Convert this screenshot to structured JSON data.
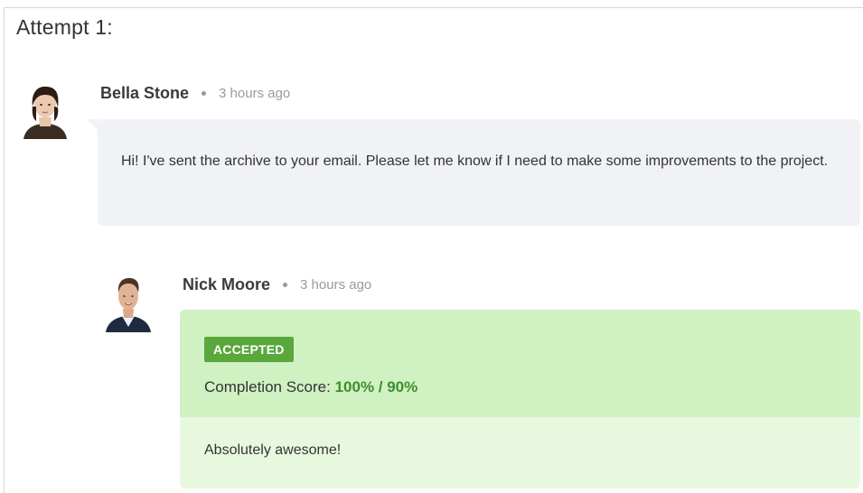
{
  "attempt": {
    "title": "Attempt 1:"
  },
  "comments": [
    {
      "author": "Bella Stone",
      "time": "3 hours ago",
      "text": "Hi! I've sent the archive to your email. Please let me know if I need to make some improvements to the project."
    },
    {
      "author": "Nick Moore",
      "time": "3 hours ago",
      "status": "ACCEPTED",
      "score_label": "Completion Score:",
      "score_value": "100% / 90%",
      "text": "Absolutely awesome!"
    }
  ],
  "colors": {
    "accepted_badge": "#5aa83c",
    "score_value": "#3d8e2f",
    "result_band": "#d0f1c2",
    "reply_bg": "#e8f8df",
    "student_bubble": "#f0f2f6"
  }
}
